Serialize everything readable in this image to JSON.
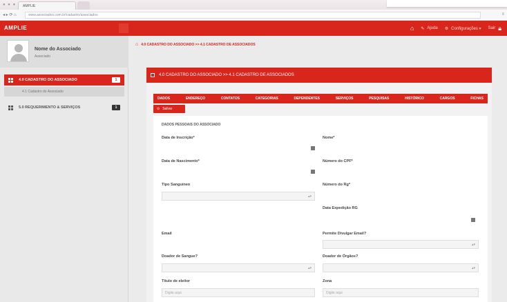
{
  "browser": {
    "tab_title": "AMPLIE",
    "url": "www.associados.com.br/cadastro/associados",
    "nav_icons": "◂ ▸ ⟳ ⌂",
    "menu_icon": "≡"
  },
  "header": {
    "brand": "AMPLIE",
    "items": [
      {
        "icon": "home-icon",
        "label": ""
      },
      {
        "icon": "wrench-icon",
        "label": "Ajuda"
      },
      {
        "icon": "gear-icon",
        "label": "Configurações ▾"
      },
      {
        "icon": "lock-icon",
        "label": "Sair"
      }
    ]
  },
  "sidebar": {
    "profile_name": "Nome do Associado",
    "profile_role": "Associado",
    "items": [
      {
        "label": "4.0 CADASTRO DO ASSOCIADO",
        "badge": "1",
        "active": true
      },
      {
        "label": "5.0 REQUERIMENTO & SERVIÇOS",
        "badge": "1",
        "active": false
      }
    ],
    "subitem": "4.1 Cadastro do Associado"
  },
  "breadcrumb": "4.0 CADASTRO DO ASSOCIADO >> 4.1 CADASTRO DE ASSOCIADOS",
  "panel": {
    "title": "4.0 CADASTRO DO ASSOCIADO >> 4.1 CADASTRO DE ASSOCIADOS"
  },
  "tabs": [
    "Dados",
    "Endereço",
    "Contatos",
    "Categorias",
    "Dependentes",
    "Serviços",
    "Pesquisas",
    "Histórico",
    "Cargos",
    "Fichas"
  ],
  "save_button": "Salvar",
  "form": {
    "section_title": "DADOS PESSOAIS DO ASSOCIADO",
    "fields": {
      "data_inscricao": "Data de Inscrição*",
      "nome": "Nome*",
      "data_nascimento": "Data de Nascimento*",
      "numero_cpf": "Número do CPF*",
      "tipo_sanguineo": "Tipo Sanguíneo",
      "numero_rg": "Número do Rg*",
      "data_expedicao": "Data Expedição RG",
      "email": "Email",
      "permite_divulgar": "Permite Divulgar Email?",
      "doador_sangue": "Doador de Sangue?",
      "doador_orgaos": "Doador de Órgãos?",
      "titulo_eleitor": "Título de eleitor",
      "zona": "Zona"
    },
    "placeholder": "Digite aqui"
  }
}
